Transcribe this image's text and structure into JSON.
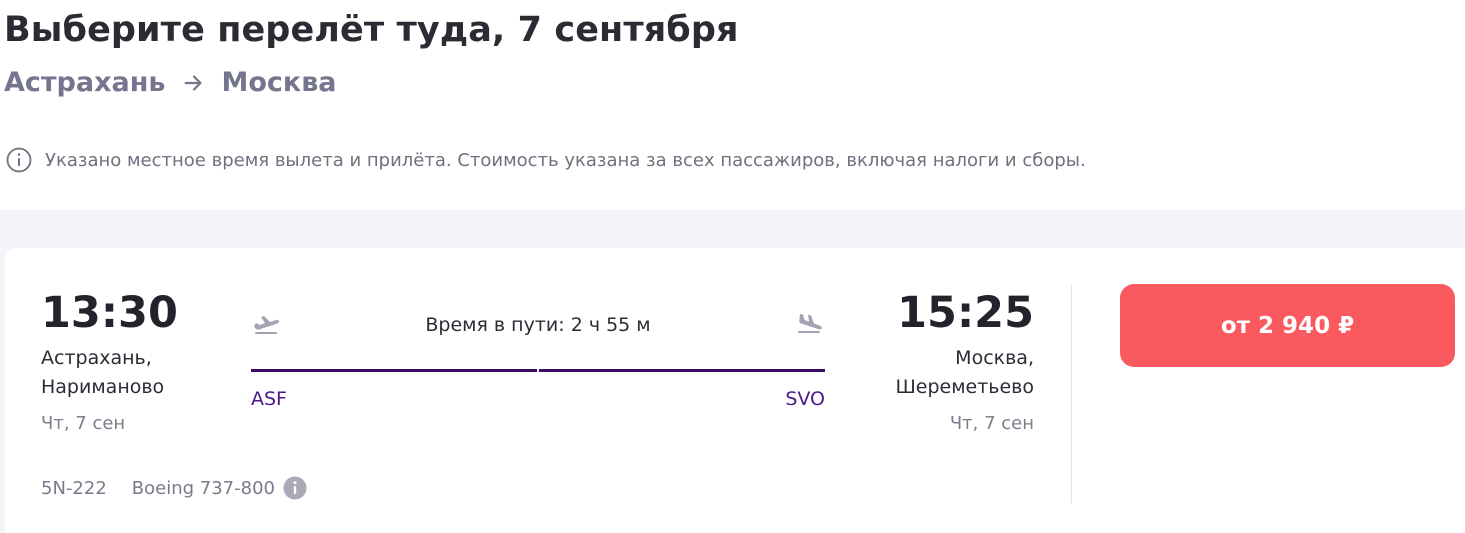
{
  "header": {
    "title": "Выберите перелёт туда, 7 сентября",
    "route_from": "Астрахань",
    "route_to": "Москва"
  },
  "notice": {
    "icon": "info-circle-icon",
    "text": "Указано местное время вылета и прилёта. Стоимость указана за всех пассажиров, включая налоги и сборы."
  },
  "flight": {
    "departure": {
      "time": "13:30",
      "city": "Астрахань,",
      "airport": "Нариманово",
      "date": "Чт, 7 сен",
      "code": "ASF"
    },
    "arrival": {
      "time": "15:25",
      "city": "Москва,",
      "airport": "Шереметьево",
      "date": "Чт, 7 сен",
      "code": "SVO"
    },
    "duration": "Время в пути: 2 ч 55 м",
    "flight_number": "5N-222",
    "aircraft": "Boeing 737-800",
    "price_label": "от 2 940 ₽"
  },
  "colors": {
    "price_button": "#fa5a5f",
    "track": "#3a0c63",
    "airport_code": "#4a1a85",
    "muted_text": "#75758f"
  }
}
